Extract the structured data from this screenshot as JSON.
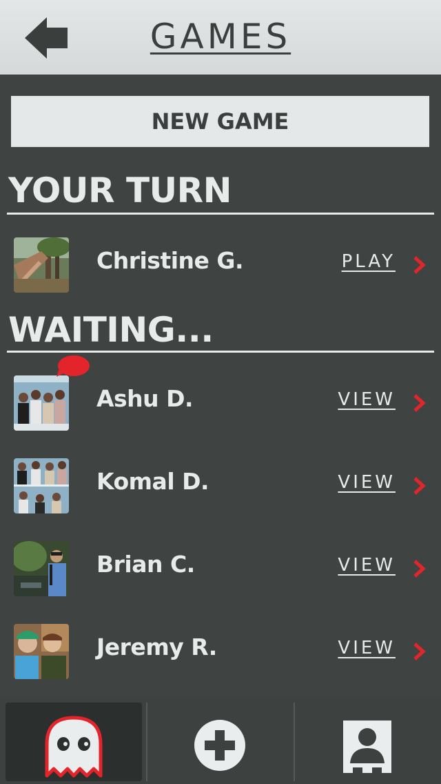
{
  "header": {
    "title": "GAMES",
    "back_icon": "back-arrow-icon"
  },
  "new_game_label": "NEW GAME",
  "sections": {
    "your_turn": "YOUR TURN",
    "waiting": "WAITING..."
  },
  "your_turn_games": [
    {
      "name": "Christine G.",
      "action": "PLAY"
    }
  ],
  "waiting_games": [
    {
      "name": "Ashu D.",
      "action": "VIEW",
      "has_badge": true
    },
    {
      "name": "Komal D.",
      "action": "VIEW"
    },
    {
      "name": "Brian C.",
      "action": "VIEW"
    },
    {
      "name": "Jeremy R.",
      "action": "VIEW"
    }
  ],
  "tabs": [
    {
      "icon": "ghost-icon",
      "active": true
    },
    {
      "icon": "plus-circle-icon",
      "active": false
    },
    {
      "icon": "profile-icon",
      "active": false
    }
  ],
  "colors": {
    "accent": "#e3242b",
    "background": "#3f4442",
    "header": "#dfe3e3",
    "text": "#e7ebea"
  }
}
